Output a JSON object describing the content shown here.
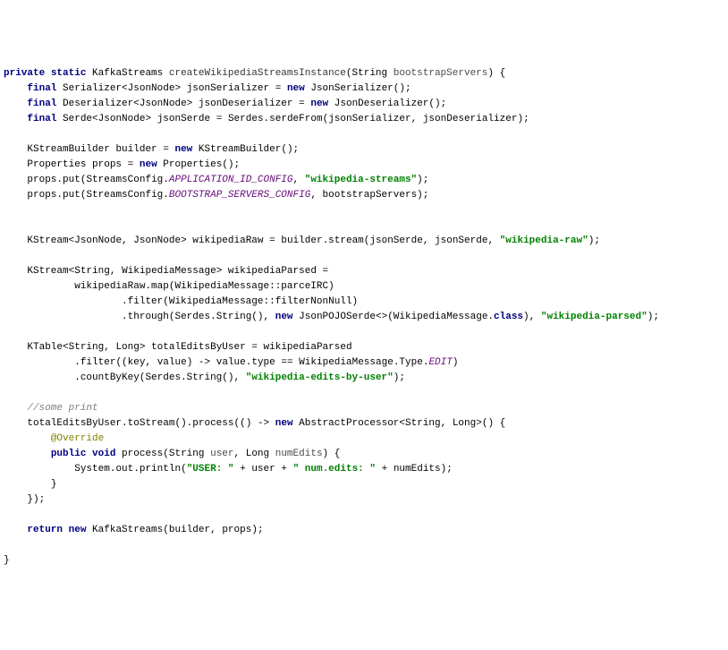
{
  "code": {
    "kw_private": "private",
    "kw_static": "static",
    "kw_final": "final",
    "kw_new": "new",
    "kw_return": "return",
    "kw_public": "public",
    "kw_void": "void",
    "ann_override": "@Override",
    "type_KafkaStreams": "KafkaStreams",
    "method_name": "createWikipediaStreamsInstance",
    "param_type_String": "String",
    "param_bootstrapServers": "bootstrapServers",
    "type_Serializer": "Serializer",
    "type_JsonNode": "JsonNode",
    "var_jsonSerializer": "jsonSerializer",
    "type_JsonSerializer": "JsonSerializer",
    "type_Deserializer": "Deserializer",
    "var_jsonDeserializer": "jsonDeserializer",
    "type_JsonDeserializer": "JsonDeserializer",
    "type_Serde": "Serde",
    "var_jsonSerde": "jsonSerde",
    "type_Serdes": "Serdes",
    "method_serdeFrom": "serdeFrom",
    "type_KStreamBuilder": "KStreamBuilder",
    "var_builder": "builder",
    "type_Properties": "Properties",
    "var_props": "props",
    "method_put": "put",
    "type_StreamsConfig": "StreamsConfig",
    "const_APPLICATION_ID": "APPLICATION_ID_CONFIG",
    "str_wikipedia_streams": "\"wikipedia-streams\"",
    "const_BOOTSTRAP_SERVERS": "BOOTSTRAP_SERVERS_CONFIG",
    "type_KStream": "KStream",
    "var_wikipediaRaw": "wikipediaRaw",
    "method_stream": "stream",
    "str_wikipedia_raw": "\"wikipedia-raw\"",
    "type_WikipediaMessage": "WikipediaMessage",
    "var_wikipediaParsed": "wikipediaParsed",
    "method_map": "map",
    "method_parceIRC": "parceIRC",
    "method_filter": "filter",
    "method_filterNonNull": "filterNonNull",
    "method_through": "through",
    "method_String": "String",
    "type_JsonPOJOSerde": "JsonPOJOSerde",
    "kw_class": "class",
    "str_wikipedia_parsed": "\"wikipedia-parsed\"",
    "type_KTable": "KTable",
    "type_Long": "Long",
    "var_totalEditsByUser": "totalEditsByUser",
    "lambda_key": "key",
    "lambda_value": "value",
    "field_type": "type",
    "enum_Type": "Type",
    "enum_EDIT": "EDIT",
    "method_countByKey": "countByKey",
    "str_edits_by_user": "\"wikipedia-edits-by-user\"",
    "comment_some_print": "//some print",
    "method_toStream": "toStream",
    "method_process": "process",
    "type_AbstractProcessor": "AbstractProcessor",
    "param_user": "user",
    "param_numEdits": "numEdits",
    "type_System": "System",
    "field_out": "out",
    "method_println": "println",
    "str_USER": "\"USER: \"",
    "str_num_edits": "\" num.edits: \"",
    "brace_open": "{",
    "brace_close": "}",
    "paren_open": "(",
    "paren_close": ")",
    "semi": ";",
    "comma": ",",
    "eq": "=",
    "dot": ".",
    "arrow": "->",
    "dcolon": "::",
    "lt": "<",
    "gt": ">",
    "diamond": "<>",
    "plus": "+",
    "eqeq": "=="
  }
}
